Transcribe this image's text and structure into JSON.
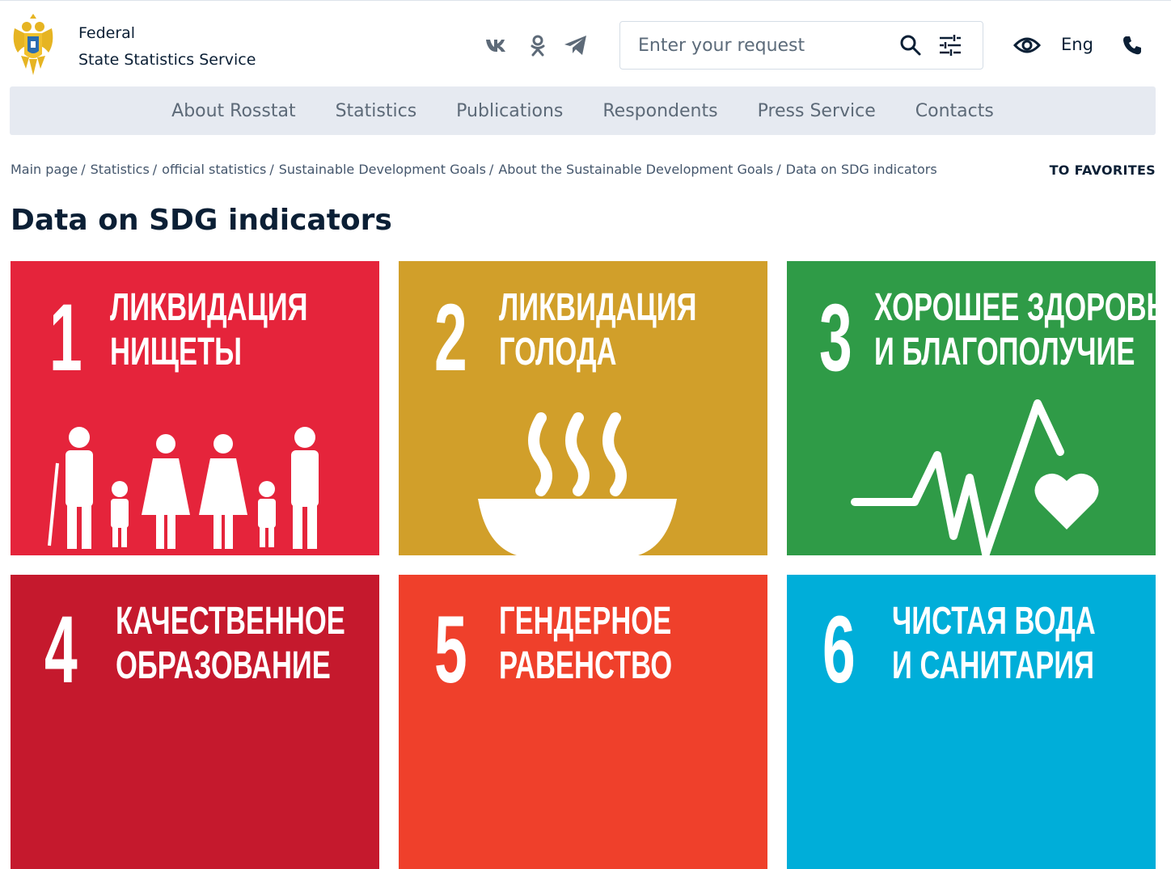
{
  "header": {
    "org_line1": "Federal",
    "org_line2": "State Statistics Service",
    "search_placeholder": "Enter your request",
    "lang": "Eng",
    "social": [
      "vk-icon",
      "odnoklassniki-icon",
      "telegram-icon"
    ],
    "icons": {
      "search": "search-icon",
      "filter": "filter-sliders-icon",
      "accessibility": "eye-icon",
      "phone": "phone-icon"
    }
  },
  "nav": {
    "items": [
      "About Rosstat",
      "Statistics",
      "Publications",
      "Respondents",
      "Press Service",
      "Contacts"
    ]
  },
  "breadcrumbs": [
    "Main page",
    "Statistics",
    "official statistics",
    "Sustainable Development Goals",
    "About the Sustainable Development Goals",
    "Data on SDG indicators"
  ],
  "favorites_label": "TO FAVORITES",
  "page_title": "Data on SDG indicators",
  "goals": [
    {
      "number": "1",
      "line1": "ликвидация",
      "line2": "нищеты",
      "color": "#e5243b",
      "icon": "family-icon"
    },
    {
      "number": "2",
      "line1": "ликвидация",
      "line2": "голода",
      "color": "#d19f2a",
      "icon": "bowl-icon"
    },
    {
      "number": "3",
      "line1": "хорошее здоровье",
      "line2": "и благополучие",
      "color": "#2f9b47",
      "icon": "heartbeat-icon"
    },
    {
      "number": "4",
      "line1": "качественное",
      "line2": "образование",
      "color": "#c5192d",
      "icon": "education-icon"
    },
    {
      "number": "5",
      "line1": "гендерное",
      "line2": "равенство",
      "color": "#ef402b",
      "icon": "gender-icon"
    },
    {
      "number": "6",
      "line1": "чистая вода",
      "line2": "и санитария",
      "color": "#00aed9",
      "icon": "water-icon"
    }
  ]
}
